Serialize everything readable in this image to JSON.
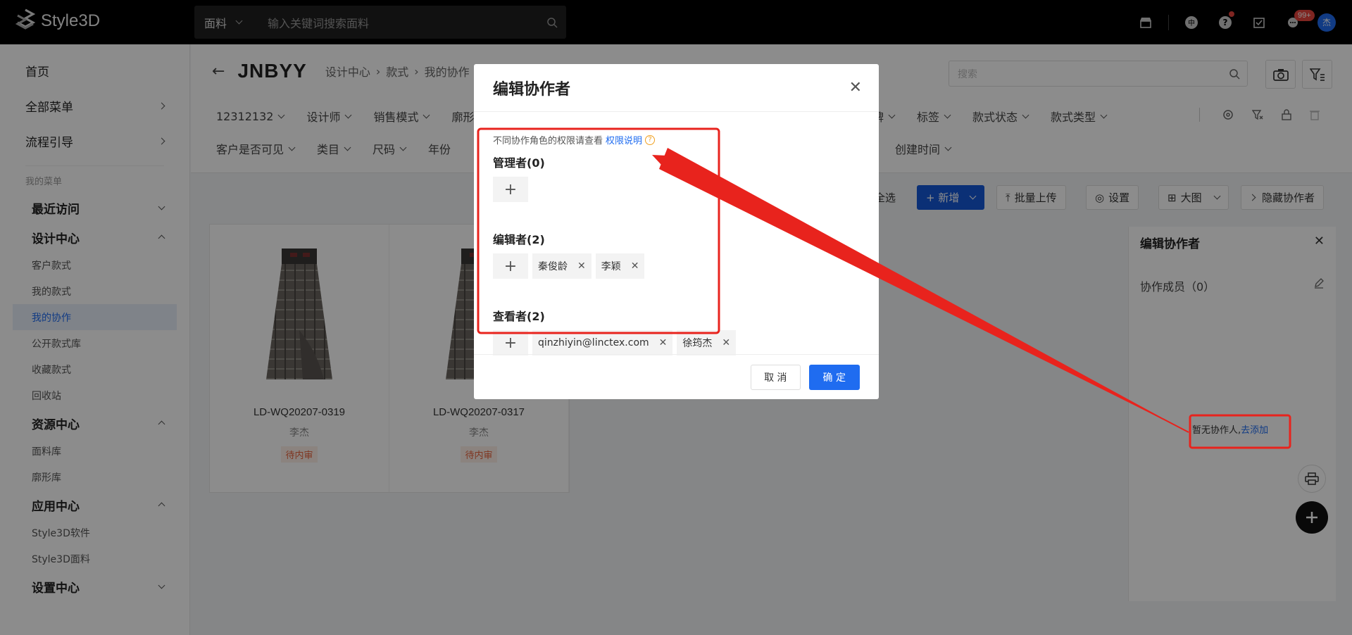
{
  "app": {
    "logo_text": "Style3D"
  },
  "top_search": {
    "category": "面料",
    "placeholder": "输入关键词搜索面料"
  },
  "top_icons": {
    "message_badge": "99+",
    "avatar_text": "杰",
    "lang_text": "中"
  },
  "sidebar": {
    "main": [
      {
        "label": "首页"
      },
      {
        "label": "全部菜单"
      },
      {
        "label": "流程引导"
      }
    ],
    "section_label": "我的菜单",
    "recent": "最近访问",
    "design_center": "设计中心",
    "design_items": [
      "客户款式",
      "我的款式",
      "我的协作",
      "公开款式库",
      "收藏款式",
      "回收站"
    ],
    "resource_center": "资源中心",
    "resource_items": [
      "面料库",
      "廓形库"
    ],
    "app_center": "应用中心",
    "app_items": [
      "Style3D软件",
      "Style3D面料"
    ],
    "settings_center": "设置中心"
  },
  "header": {
    "title": "JNBYY",
    "breadcrumbs": [
      "设计中心",
      "款式",
      "我的协作"
    ],
    "search_placeholder": "搜索",
    "filters_row1": [
      "12312132",
      "设计师",
      "销售模式",
      "廓形"
    ],
    "filters_row1_right": [
      "牌",
      "标签",
      "款式状态",
      "款式类型"
    ],
    "filters_row2": [
      "客户是否可见",
      "类目",
      "尺码",
      "年份"
    ],
    "filters_row2_right": [
      "创建时间"
    ]
  },
  "toolbar": {
    "select_all": "全选",
    "add": "+ 新增",
    "batch_upload": "批量上传",
    "settings": "设置",
    "view": "大图",
    "hide_collab": "隐藏协作者"
  },
  "cards": [
    {
      "code": "LD-WQ20207-0319",
      "owner": "李杰",
      "status": "待内审"
    },
    {
      "code": "LD-WQ20207-0317",
      "owner": "李杰",
      "status": "待内审"
    }
  ],
  "right_panel": {
    "title": "编辑协作者",
    "members_label": "协作成员（0）",
    "empty_text": "暂无协作人,",
    "empty_link": "去添加"
  },
  "modal": {
    "title": "编辑协作者",
    "hint": "不同协作角色的权限请查看",
    "hint_link": "权限说明",
    "roles": [
      {
        "name": "管理者(0)",
        "members": []
      },
      {
        "name": "编辑者(2)",
        "members": [
          "秦俊龄",
          "李颖"
        ]
      },
      {
        "name": "查看者(2)",
        "members": [
          "qinzhiyin@linctex.com",
          "徐筠杰"
        ]
      }
    ],
    "cancel": "取 消",
    "ok": "确 定"
  },
  "colors": {
    "primary": "#1f6cf0",
    "annotation": "#e8231d",
    "status": "#e8633c"
  }
}
